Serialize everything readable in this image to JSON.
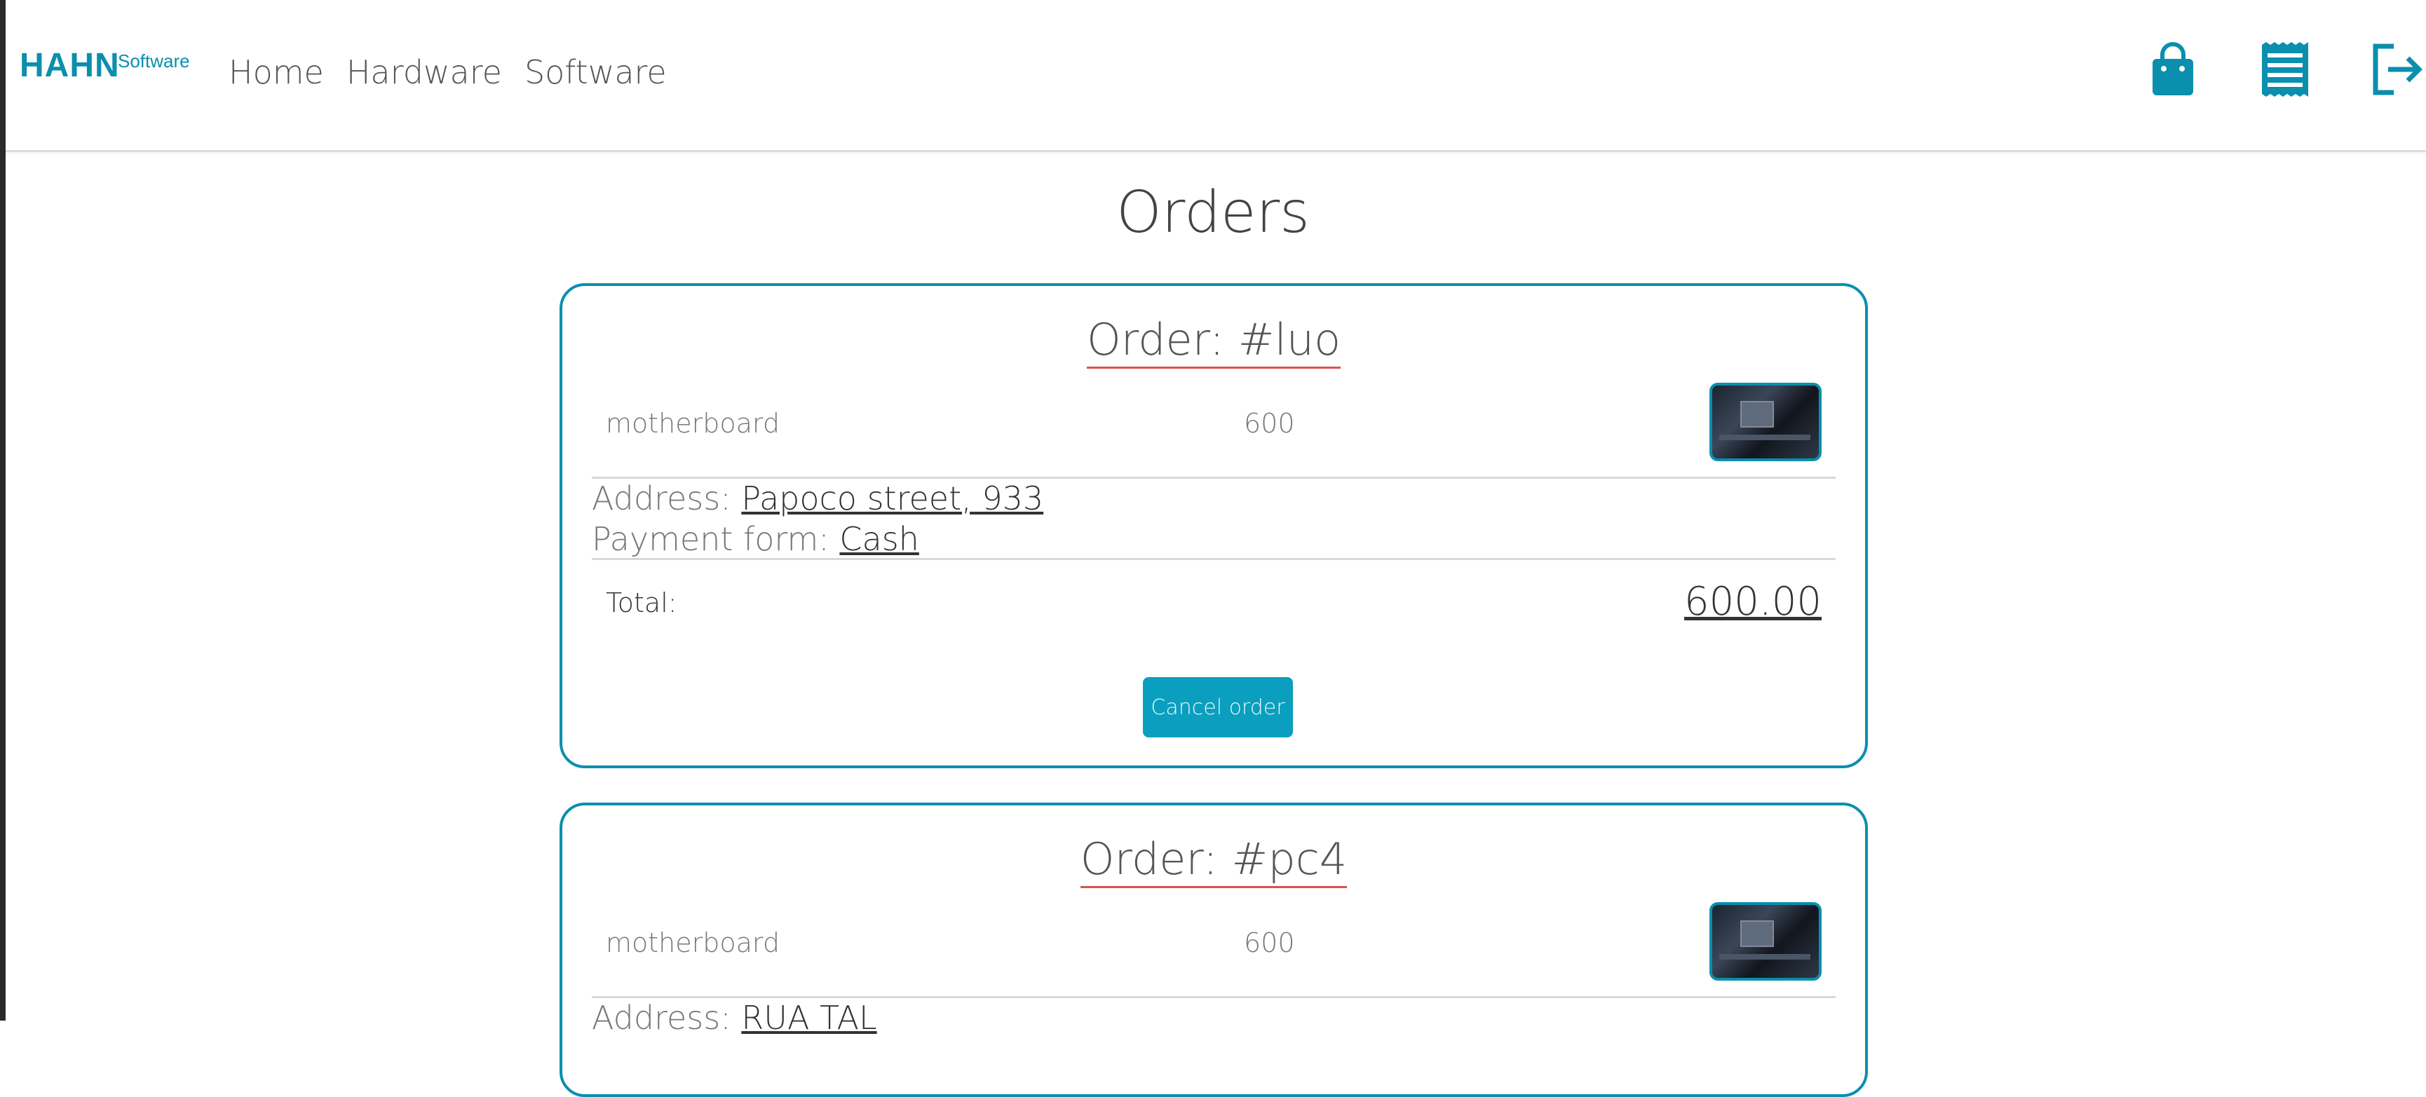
{
  "header": {
    "logo_main": "HAHN",
    "logo_sup": "Software",
    "nav": [
      {
        "label": "Home"
      },
      {
        "label": "Hardware"
      },
      {
        "label": "Software"
      }
    ],
    "icons": [
      "shopping-bag-icon",
      "receipt-icon",
      "logout-icon"
    ],
    "accent_color": "#0a8fae"
  },
  "page": {
    "title": "Orders"
  },
  "orders": [
    {
      "title": "Order: #luo",
      "item_name": "motherboard",
      "item_price": "600",
      "address_label": "Address: ",
      "address": "Papoco street, 933",
      "payment_label": "Payment form: ",
      "payment": "Cash",
      "total_label": "Total:",
      "total": "600.00",
      "cancel_label": "Cancel order"
    },
    {
      "title": "Order: #pc4",
      "item_name": "motherboard",
      "item_price": "600",
      "address_label": "Address: ",
      "address": "RUA TAL"
    }
  ],
  "colors": {
    "accent": "#0a8fae",
    "button": "#0a9fbf",
    "title_underline": "#d9534f"
  }
}
